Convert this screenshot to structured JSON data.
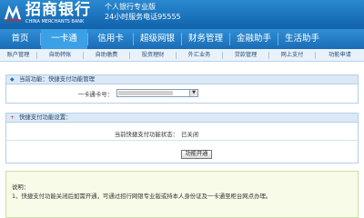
{
  "header": {
    "brand": "招商银行",
    "brand_en": "CHINA MERCHANTS BANK",
    "slogan_line1": "个人银行专业版",
    "slogan_line2": "24小时服务电话95555"
  },
  "nav": {
    "items": [
      {
        "label": "首页"
      },
      {
        "label": "一卡通"
      },
      {
        "label": "信用卡"
      },
      {
        "label": "超级网银"
      },
      {
        "label": "财务管理"
      },
      {
        "label": "金融助手"
      },
      {
        "label": "生活助手"
      }
    ],
    "active": "一卡通"
  },
  "subnav": {
    "items": [
      {
        "label": "账户管理"
      },
      {
        "label": "自助转账"
      },
      {
        "label": "自助缴费"
      },
      {
        "label": "投资理财"
      },
      {
        "label": "外汇业务"
      },
      {
        "label": "贷款管理"
      },
      {
        "label": "网上支付"
      },
      {
        "label": "功能申请"
      }
    ]
  },
  "current_function": {
    "label": "当前功能：快捷支付功能管理"
  },
  "card_select": {
    "label": "一卡通卡号：",
    "value": ""
  },
  "settings": {
    "header": "快捷支付功能设置：",
    "status_label": "当前快捷支付功能状态：",
    "status_value": "已关闭",
    "button_label": "功能开通"
  },
  "note": {
    "title": "说明：",
    "text": "1、快捷支付功能关闭后如需开通，可通过招行网银专业版或持本人身份证及一卡通至柜台网点办理。"
  },
  "colors": {
    "header_blue": "#1162ab",
    "active_tab": "#3ba0e6",
    "note_bg": "#f7fbe7"
  }
}
